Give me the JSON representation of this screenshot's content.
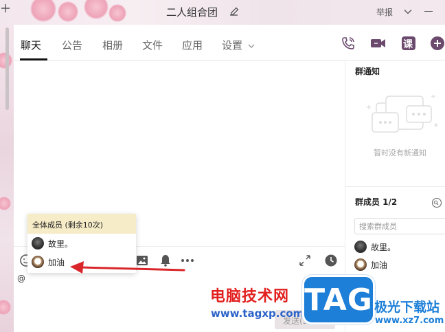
{
  "window": {
    "title": "二人组合团",
    "report_label": "举报"
  },
  "tabs": [
    {
      "label": "聊天"
    },
    {
      "label": "公告"
    },
    {
      "label": "相册"
    },
    {
      "label": "文件"
    },
    {
      "label": "应用"
    },
    {
      "label": "设置"
    }
  ],
  "toolbar_right": {
    "course_label": "课"
  },
  "notice": {
    "title": "群通知",
    "empty_text": "暂时没有新通知"
  },
  "members": {
    "title": "群成员 1/2",
    "search_placeholder": "搜索群成员",
    "list": [
      {
        "name": "故里。",
        "avatar": "dark"
      },
      {
        "name": "加油",
        "avatar": "cute"
      }
    ]
  },
  "mention_popup": {
    "all_label": "全体成员 (剩余10次)",
    "items": [
      {
        "name": "故里。",
        "avatar": "dark"
      },
      {
        "name": "加油",
        "avatar": "cute"
      }
    ]
  },
  "input": {
    "text": "@"
  },
  "send": {
    "label": "发送(S)"
  },
  "watermark": {
    "site_cn": "电脑技术网",
    "site_url": "www.tagxp.com",
    "logo_text": "TAG",
    "xz_cn": "极光下载站",
    "xz_url": "www.xz7.com"
  },
  "colors": {
    "accent": "#6b4a6e",
    "mention_all_bg": "#f6ecc8",
    "annotation_red": "#d9262a",
    "watermark_red": "#e21f1f",
    "watermark_blue": "#1d7fd8"
  }
}
